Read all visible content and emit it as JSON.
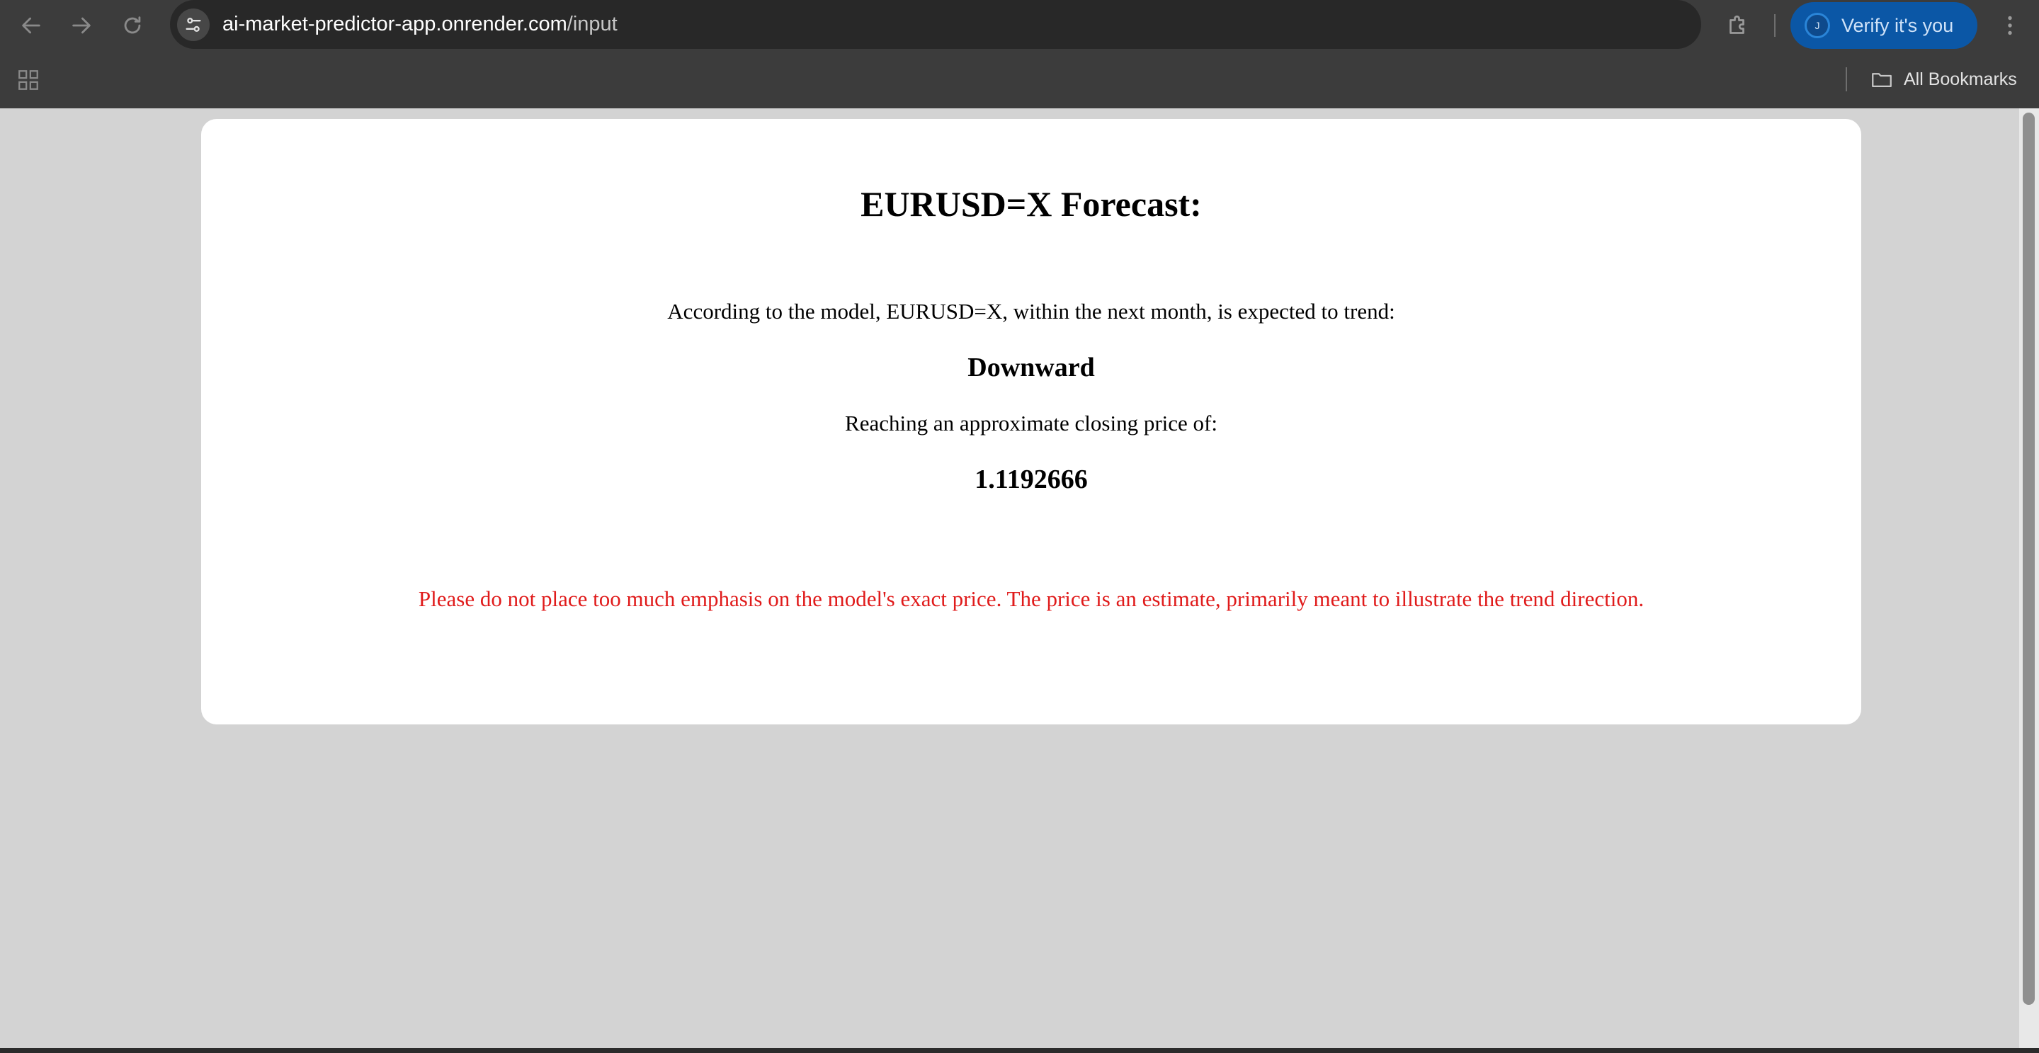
{
  "browser": {
    "url_host": "ai-market-predictor-app.onrender.com",
    "url_path": "/input",
    "verify_label": "Verify it's you",
    "avatar_letter": "J",
    "all_bookmarks_label": "All Bookmarks",
    "icons": {
      "back": "arrow-left-icon",
      "forward": "arrow-right-icon",
      "reload": "reload-icon",
      "site_info": "tune-icon",
      "bookmark_star": "star-icon",
      "extensions": "puzzle-icon",
      "menu": "kebab-menu-icon",
      "apps": "apps-grid-icon",
      "folder": "folder-icon"
    }
  },
  "page": {
    "title": "EURUSD=X Forecast:",
    "intro": "According to the model, EURUSD=X, within the next month, is expected to trend:",
    "trend": "Downward",
    "price_intro": "Reaching an approximate closing price of:",
    "price": "1.1192666",
    "disclaimer": "Please do not place too much emphasis on the model's exact price. The price is an estimate, primarily meant to illustrate the trend direction.",
    "disclaimer_color": "#e01b1b",
    "background_color": "#d3d3d3"
  }
}
